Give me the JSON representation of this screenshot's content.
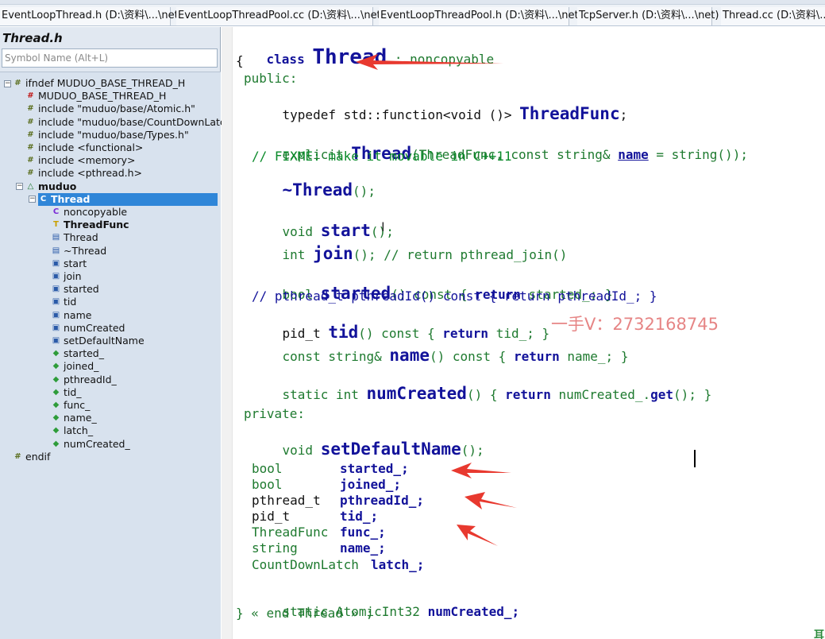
{
  "tabs": [
    "EventLoopThread.h (D:\\资料\\...\\net)",
    "EventLoopThreadPool.cc (D:\\资料\\...\\net)",
    "EventLoopThreadPool.h (D:\\资料\\...\\net)",
    "TcpServer.h (D:\\资料\\...\\net)",
    "Thread.cc (D:\\资料\\...\\b"
  ],
  "symbol_panel": {
    "title": "Thread.h",
    "search_placeholder": "Symbol Name (Alt+L)",
    "tree": [
      {
        "label": "ifndef MUDUO_BASE_THREAD_H",
        "icon": "preprocessor-icon"
      },
      {
        "label": "MUDUO_BASE_THREAD_H",
        "icon": "define-icon"
      },
      {
        "label": "include \"muduo/base/Atomic.h\"",
        "icon": "preprocessor-icon"
      },
      {
        "label": "include \"muduo/base/CountDownLatch",
        "icon": "preprocessor-icon"
      },
      {
        "label": "include \"muduo/base/Types.h\"",
        "icon": "preprocessor-icon"
      },
      {
        "label": "include <functional>",
        "icon": "preprocessor-icon"
      },
      {
        "label": "include <memory>",
        "icon": "preprocessor-icon"
      },
      {
        "label": "include <pthread.h>",
        "icon": "preprocessor-icon"
      },
      {
        "label": "muduo",
        "icon": "namespace-icon"
      },
      {
        "label": "Thread",
        "icon": "class-icon",
        "selected": true
      },
      {
        "label": "noncopyable",
        "icon": "class-icon"
      },
      {
        "label": "ThreadFunc",
        "icon": "typedef-icon"
      },
      {
        "label": "Thread",
        "icon": "constructor-icon"
      },
      {
        "label": "~Thread",
        "icon": "destructor-icon"
      },
      {
        "label": "start",
        "icon": "method-icon"
      },
      {
        "label": "join",
        "icon": "method-icon"
      },
      {
        "label": "started",
        "icon": "method-icon"
      },
      {
        "label": "tid",
        "icon": "method-icon"
      },
      {
        "label": "name",
        "icon": "method-icon"
      },
      {
        "label": "numCreated",
        "icon": "method-icon"
      },
      {
        "label": "setDefaultName",
        "icon": "method-icon"
      },
      {
        "label": "started_",
        "icon": "field-icon"
      },
      {
        "label": "joined_",
        "icon": "field-icon"
      },
      {
        "label": "pthreadId_",
        "icon": "field-icon"
      },
      {
        "label": "tid_",
        "icon": "field-icon"
      },
      {
        "label": "func_",
        "icon": "field-icon"
      },
      {
        "label": "name_",
        "icon": "field-icon"
      },
      {
        "label": "latch_",
        "icon": "field-icon"
      },
      {
        "label": "numCreated_",
        "icon": "field-icon"
      },
      {
        "label": "endif",
        "icon": "preprocessor-icon"
      }
    ]
  },
  "code": {
    "l1_kw": "class",
    "l1_name": "Thread",
    "l1_rest": ": noncopyable",
    "l2": "{",
    "l3": "public:",
    "l4_a": "typedef std::function<void ()>",
    "l4_name": "ThreadFunc",
    "l4_end": ";",
    "l5_kw": "explicit",
    "l5_name": "Thread",
    "l5_a": "(ThreadFunc, const string&",
    "l5_param": "name",
    "l5_b": "= string());",
    "l6": "// FIXME: make it movable in C++11",
    "l7_name": "~Thread",
    "l7_end": "();",
    "l8_kw": "void",
    "l8_name": "start",
    "l8_end": "();",
    "l9_kw": "int",
    "l9_name": "join",
    "l9_end": "(); // return pthread_join()",
    "l10_kw": "bool",
    "l10_name": "started",
    "l10_a": "() const {",
    "l10_ret": "return",
    "l10_b": "started_; }",
    "l11": "// pthread_t pthreadId() const { return pthreadId_; }",
    "l12_kw": "pid_t",
    "l12_name": "tid",
    "l12_a": "() const {",
    "l12_ret": "return",
    "l12_b": "tid_; }",
    "l13_kw": "const string&",
    "l13_name": "name",
    "l13_a": "() const {",
    "l13_ret": "return",
    "l13_b": "name_; }",
    "l14_kw": "static int",
    "l14_name": "numCreated",
    "l14_a": "() {",
    "l14_ret": "return",
    "l14_b": "numCreated_.",
    "l14_get": "get",
    "l14_c": "(); }",
    "l15": "private:",
    "l16_kw": "void",
    "l16_name": "setDefaultName",
    "l16_end": "();",
    "fields": [
      {
        "type": "bool",
        "name": "started_;"
      },
      {
        "type": "bool",
        "name": "joined_;"
      },
      {
        "type": "pthread_t",
        "name": "pthreadId_;"
      },
      {
        "type": "pid_t",
        "name": "tid_;"
      },
      {
        "type": "ThreadFunc",
        "name": "func_;"
      },
      {
        "type": "string",
        "name": "name_;"
      },
      {
        "type": "CountDownLatch",
        "name": "latch_;"
      }
    ],
    "l24_kw": "static AtomicInt32",
    "l24_name": "numCreated_;",
    "l25": "} « end Thread » ;"
  },
  "watermark": "一手V：2732168745",
  "caret_glyph": "I",
  "corner_mark": "耳",
  "colors": {
    "selection": "#2f86d8",
    "arrow": "#e8392f",
    "watermark": "#e68585"
  }
}
